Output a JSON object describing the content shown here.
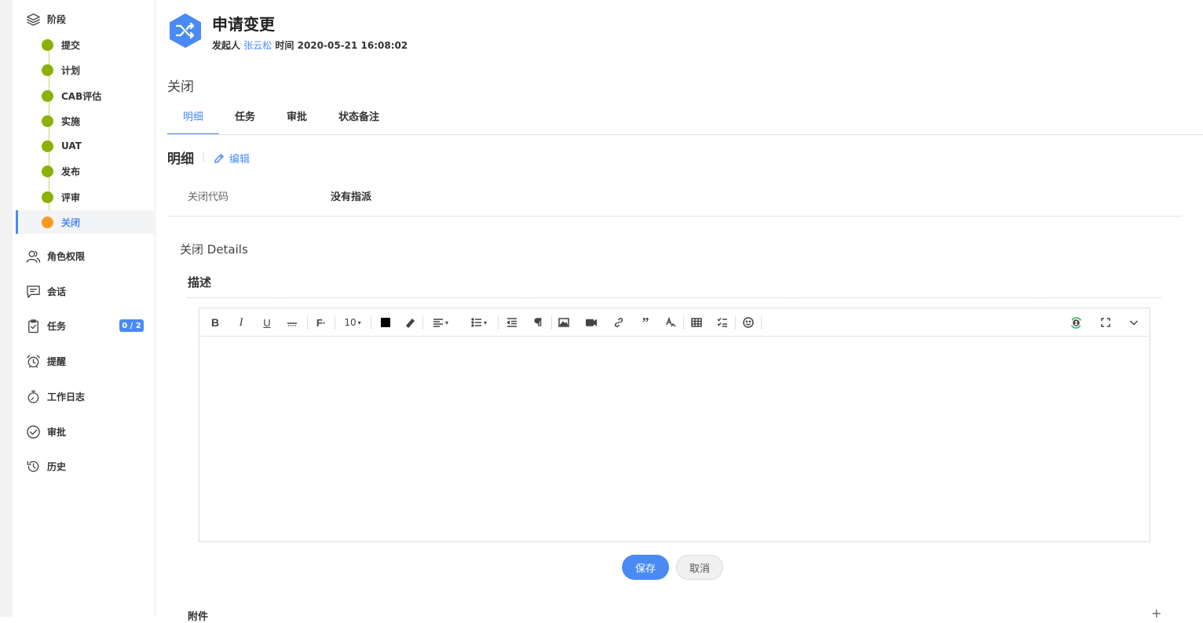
{
  "sidebar": {
    "stages_header": "阶段",
    "stages": [
      {
        "label": "提交",
        "state": "done"
      },
      {
        "label": "计划",
        "state": "done"
      },
      {
        "label": "CAB评估",
        "state": "done"
      },
      {
        "label": "实施",
        "state": "done"
      },
      {
        "label": "UAT",
        "state": "done"
      },
      {
        "label": "发布",
        "state": "done"
      },
      {
        "label": "评审",
        "state": "done"
      },
      {
        "label": "关闭",
        "state": "current"
      }
    ],
    "items": [
      {
        "label": "角色权限",
        "icon": "users-icon"
      },
      {
        "label": "会话",
        "icon": "chat-icon"
      },
      {
        "label": "任务",
        "icon": "clipboard-icon",
        "badge": "0 / 2"
      },
      {
        "label": "提醒",
        "icon": "alarm-icon"
      },
      {
        "label": "工作日志",
        "icon": "stopwatch-icon"
      },
      {
        "label": "审批",
        "icon": "check-circle-icon"
      },
      {
        "label": "历史",
        "icon": "history-icon"
      }
    ]
  },
  "header": {
    "title": "申请变更",
    "initiator_label": "发起人",
    "initiator": "张云松",
    "time_label": "时间",
    "time": "2020-05-21 16:08:02",
    "phase": "关闭"
  },
  "tabs": [
    {
      "label": "明细",
      "active": true
    },
    {
      "label": "任务",
      "active": false
    },
    {
      "label": "审批",
      "active": false
    },
    {
      "label": "状态备注",
      "active": false
    }
  ],
  "detail": {
    "title": "明细",
    "edit_label": "编辑",
    "fields": [
      {
        "label": "关闭代码",
        "value": "没有指派"
      }
    ]
  },
  "close_details": {
    "title": "关闭 Details",
    "desc_label": "描述",
    "font_size": "10"
  },
  "actions": {
    "save": "保存",
    "cancel": "取消"
  },
  "attachments": {
    "label": "附件",
    "add": "+"
  },
  "colors": {
    "accent": "#4a8af4",
    "stage_done": "#8bb107",
    "stage_current": "#f79b1f"
  }
}
